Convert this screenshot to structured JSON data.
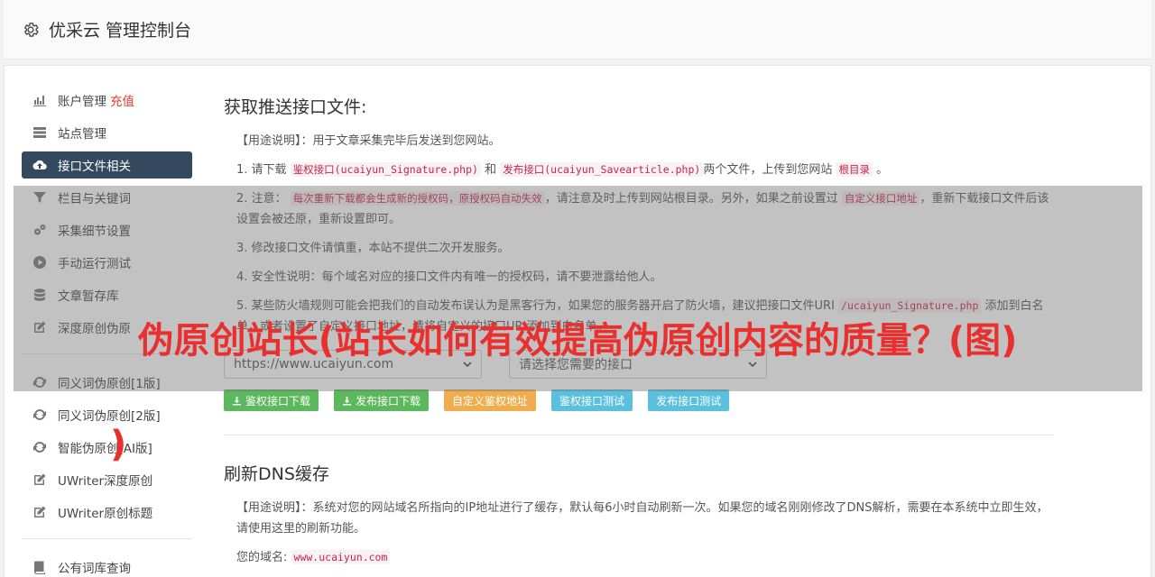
{
  "header": {
    "title": "优采云 管理控制台"
  },
  "sidebar": {
    "items": [
      {
        "label": "账户管理",
        "badge": "充值",
        "icon": "bar-chart-icon"
      },
      {
        "label": "站点管理",
        "icon": "server-icon"
      },
      {
        "label": "接口文件相关",
        "icon": "cloud-upload-icon",
        "active": true
      },
      {
        "label": "栏目与关键词",
        "icon": "filter-icon"
      },
      {
        "label": "采集细节设置",
        "icon": "cogs-icon"
      },
      {
        "label": "手动运行测试",
        "icon": "play-circle-icon"
      },
      {
        "label": "文章暂存库",
        "icon": "database-icon"
      },
      {
        "label": "深度原创伪原",
        "icon": "edit-icon"
      },
      {
        "label": "同义词伪原创[1版]",
        "icon": "refresh-icon"
      },
      {
        "label": "同义词伪原创[2版]",
        "icon": "refresh-icon"
      },
      {
        "label": "智能伪原创[AI版]",
        "icon": "refresh-icon"
      },
      {
        "label": "UWriter深度原创",
        "icon": "edit-icon"
      },
      {
        "label": "UWriter原创标题",
        "icon": "edit-icon"
      },
      {
        "label": "公有词库查询",
        "icon": "book-icon"
      }
    ]
  },
  "section1": {
    "title": "获取推送接口文件:",
    "usage_label": "【用途说明】",
    "usage_text": "：用于文章采集完毕后发送到您网站。",
    "p1": {
      "prefix": "1. 请下载",
      "code1": "鉴权接口(ucaiyun_Signature.php)",
      "mid": "和",
      "code2": "发布接口(ucaiyun_Savearticle.php)",
      "mid2": "两个文件，上传到您网站",
      "code3": "根目录",
      "suffix": "。"
    },
    "p2": {
      "prefix": "2. 注意：",
      "code1": "每次重新下载都会生成新的授权码，原授权码自动失效",
      "mid": "，请注意及时上传到网站根目录。另外，如果之前设置过",
      "code2": "自定义接口地址",
      "suffix": "，重新下载接口文件后该设置会被还原，重新设置即可。"
    },
    "p3": "3. 修改接口文件请慎重，本站不提供二次开发服务。",
    "p4": "4. 安全性说明：每个域名对应的接口文件内有唯一的授权码，请不要泄露给他人。",
    "p5": {
      "prefix": "5. 某些防火墙规则可能会把我们的自动发布误认为是黑客行为，如果您的服务器开启了防火墙，建议把接口文件URI",
      "code1": "/ucaiyun_Signature.php",
      "suffix": "添加到白名单，或者设置了自定义接口地址，请将自定义的接口URI添加到白名单。"
    },
    "select_site": "https://www.ucaiyun.com",
    "select_api": "请选择您需要的接口",
    "buttons": {
      "sig_download": "鉴权接口下载",
      "pub_download": "发布接口下载",
      "custom_sig": "自定义鉴权地址",
      "sig_test": "鉴权接口测试",
      "pub_test": "发布接口测试"
    }
  },
  "section2": {
    "title": "刷新DNS缓存",
    "usage_label": "【用途说明】",
    "usage_text": "：系统对您的网站域名所指向的IP地址进行了缓存，默认每6小时自动刷新一次。如果您的域名刚刚修改了DNS解析，需要在本系统中立即生效，请使用这里的刷新功能。",
    "domain_label": "您的域名:",
    "domain_value": "www.ucaiyun.com"
  },
  "overlay": {
    "headline": "伪原创站长(站长如何有效提高伪原创内容的质量？(图)",
    "headline_tail": ")"
  },
  "colors": {
    "active_nav": "#34495e",
    "green": "#5cb85c",
    "orange": "#f0ad4e",
    "blue": "#5bc0de",
    "headline": "#e8312f"
  }
}
